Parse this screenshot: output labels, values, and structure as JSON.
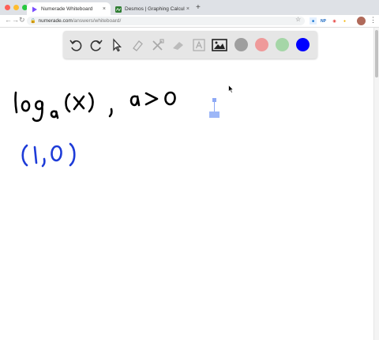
{
  "browser": {
    "tabs": [
      {
        "title": "Numerade Whiteboard",
        "active": true,
        "favicon": "numerade-play-icon"
      },
      {
        "title": "Desmos | Graphing Calculator",
        "active": false,
        "favicon": "desmos-icon"
      }
    ],
    "url_host": "numerade.com",
    "url_path": "/answers/whiteboard/",
    "new_tab_glyph": "+",
    "close_glyph": "×"
  },
  "whiteboard": {
    "tools": [
      "undo-icon",
      "redo-icon",
      "pointer-icon",
      "eraser-icon",
      "tools-icon",
      "highlighter-icon",
      "text-icon",
      "image-icon"
    ],
    "colors": [
      "#9e9e9e",
      "#ef9a9a",
      "#a5d6a7",
      "#0000ff"
    ],
    "handwriting": [
      {
        "text": "loga(x) , a>0",
        "color": "#000000"
      },
      {
        "text": "(1,0)",
        "color": "#1e3cd8"
      }
    ]
  }
}
